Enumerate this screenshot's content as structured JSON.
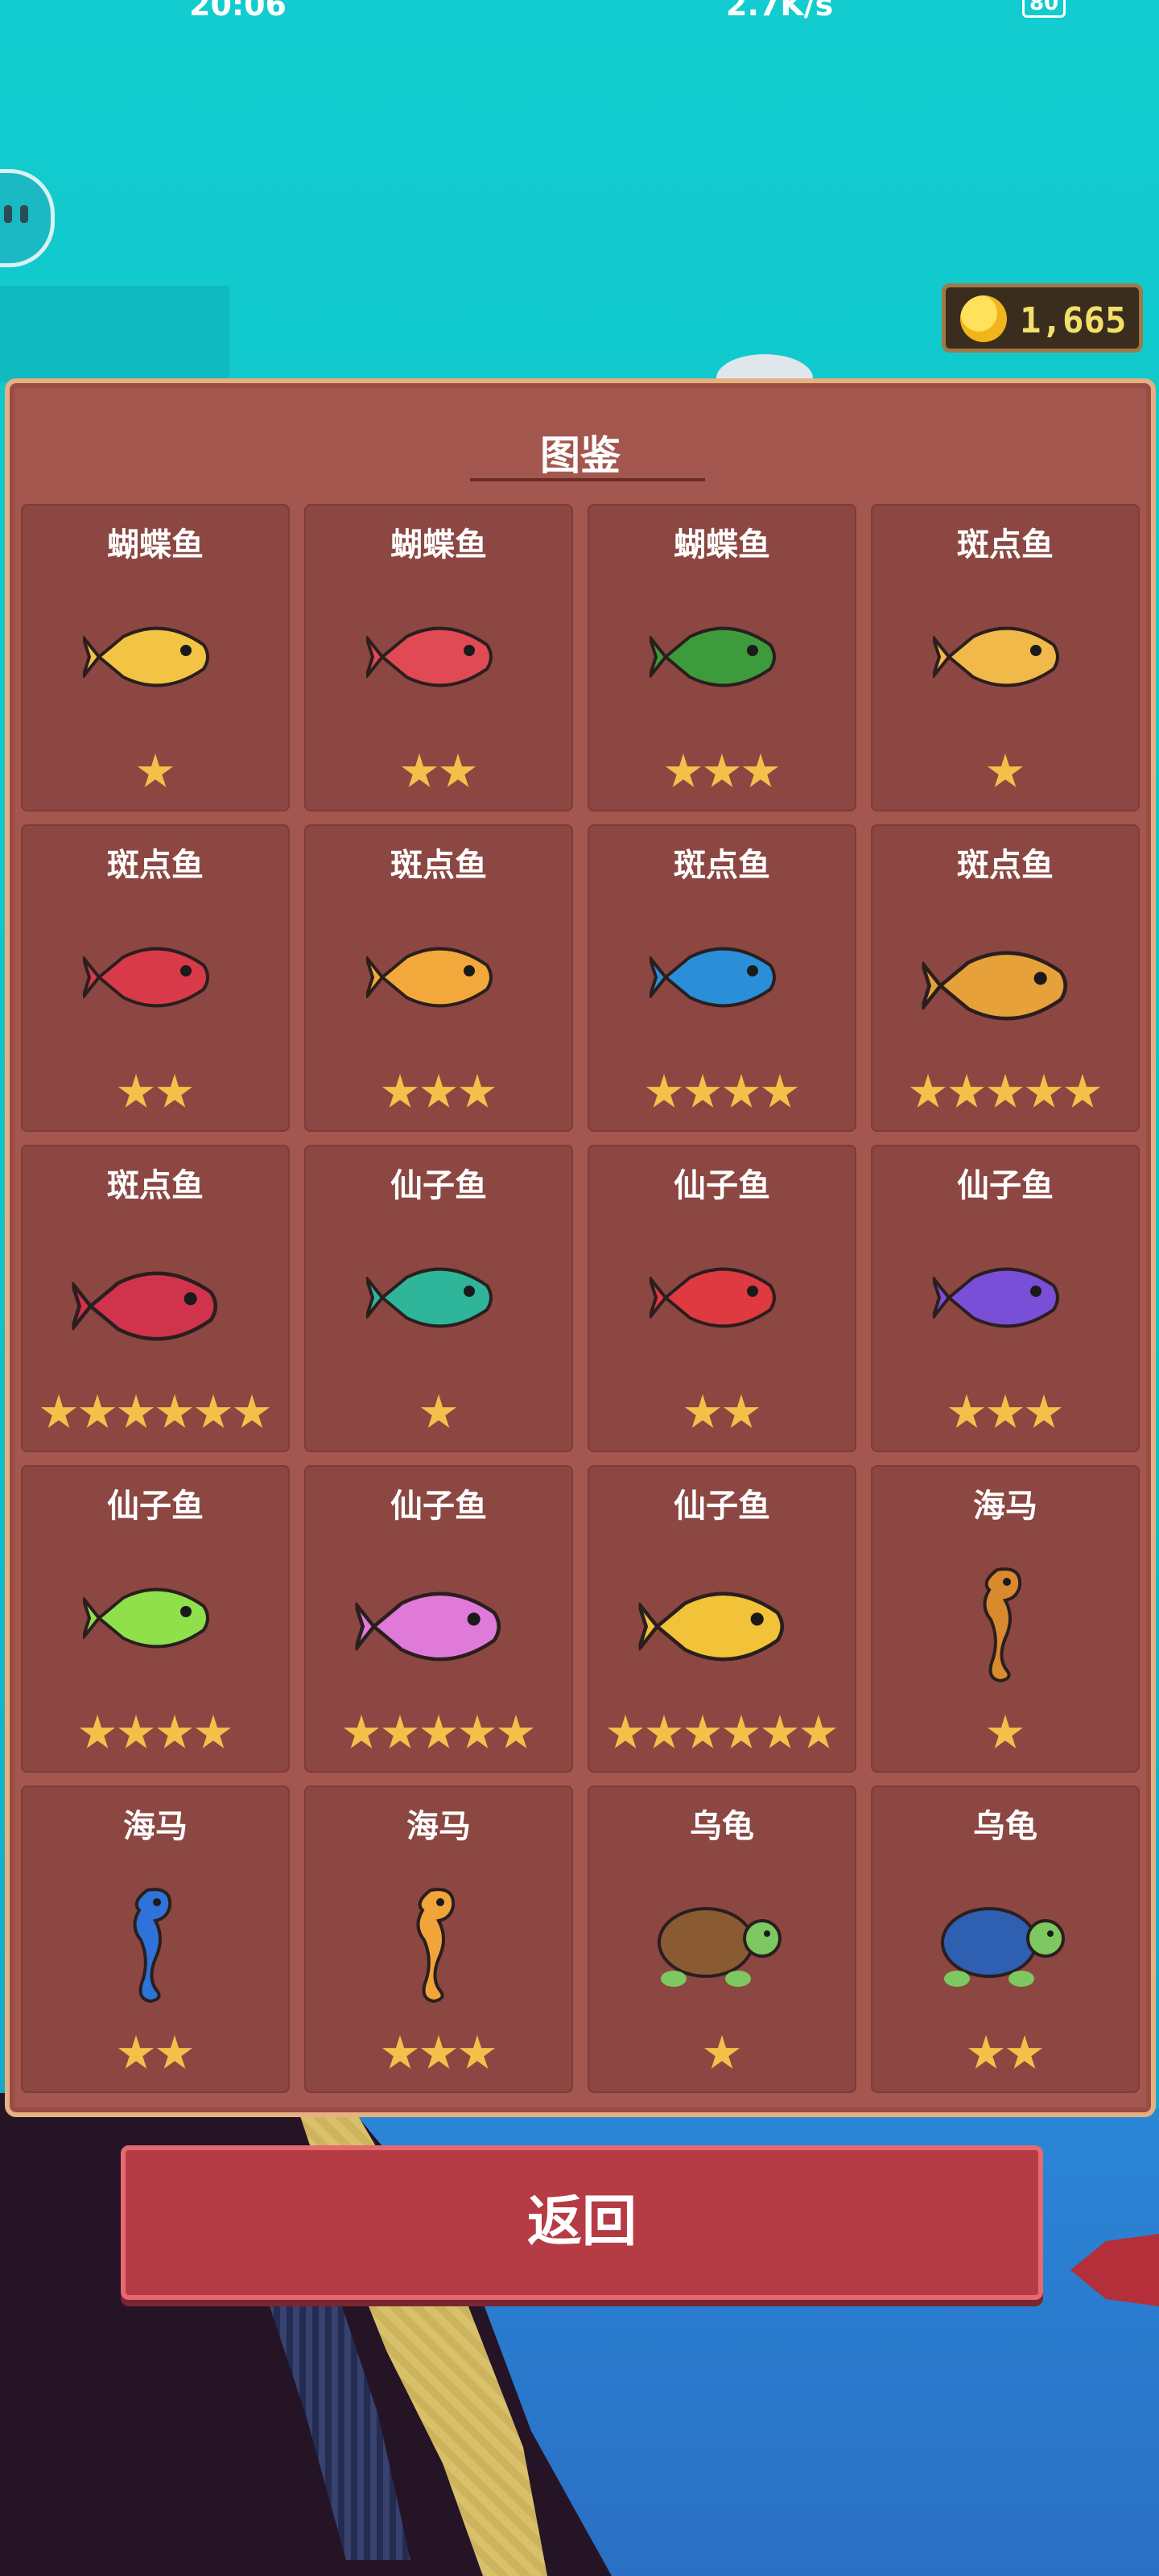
{
  "status_bar": {
    "time": "20:06",
    "net_rate": "2.7K/s",
    "battery": "80"
  },
  "coins": "1,665",
  "colors": {
    "panel": "#a4574f",
    "card": "#8c4742",
    "star": "#f5c04a",
    "button": "#b53c44",
    "coin_text": "#f3e06a"
  },
  "album": {
    "title": "图鉴",
    "items": [
      {
        "name": "蝴蝶鱼",
        "stars": 1,
        "icon": "butterflyfish-yellow",
        "color": "#f3c443"
      },
      {
        "name": "蝴蝶鱼",
        "stars": 2,
        "icon": "butterflyfish-red-green",
        "color": "#e04a55"
      },
      {
        "name": "蝴蝶鱼",
        "stars": 3,
        "icon": "butterflyfish-green-yellow",
        "color": "#3e9b3c"
      },
      {
        "name": "斑点鱼",
        "stars": 1,
        "icon": "spotfish-yellow",
        "color": "#f1b84a"
      },
      {
        "name": "斑点鱼",
        "stars": 2,
        "icon": "spotfish-red",
        "color": "#d83a4a"
      },
      {
        "name": "斑点鱼",
        "stars": 3,
        "icon": "spotfish-orange",
        "color": "#f2a83a"
      },
      {
        "name": "斑点鱼",
        "stars": 4,
        "icon": "spotfish-blue",
        "color": "#2a8fd8"
      },
      {
        "name": "斑点鱼",
        "stars": 5,
        "icon": "spotfish-gold",
        "color": "#e6a13a"
      },
      {
        "name": "斑点鱼",
        "stars": 6,
        "icon": "spotfish-red-cyan",
        "color": "#d0344c"
      },
      {
        "name": "仙子鱼",
        "stars": 1,
        "icon": "fairyfish-teal",
        "color": "#2fb59a"
      },
      {
        "name": "仙子鱼",
        "stars": 2,
        "icon": "fairyfish-red-white",
        "color": "#df3a42"
      },
      {
        "name": "仙子鱼",
        "stars": 3,
        "icon": "fairyfish-purple",
        "color": "#7a4fd8"
      },
      {
        "name": "仙子鱼",
        "stars": 4,
        "icon": "fairyfish-lime",
        "color": "#8fe04b"
      },
      {
        "name": "仙子鱼",
        "stars": 5,
        "icon": "fairyfish-pink",
        "color": "#e07ad8"
      },
      {
        "name": "仙子鱼",
        "stars": 6,
        "icon": "fairyfish-yellow-white",
        "color": "#f2c238"
      },
      {
        "name": "海马",
        "stars": 1,
        "icon": "seahorse-orange",
        "color": "#d98a2e"
      },
      {
        "name": "海马",
        "stars": 2,
        "icon": "seahorse-blue",
        "color": "#2f73d8"
      },
      {
        "name": "海马",
        "stars": 3,
        "icon": "seahorse-gold",
        "color": "#f0a43a"
      },
      {
        "name": "乌龟",
        "stars": 1,
        "icon": "turtle-brown",
        "color": "#8a5a33"
      },
      {
        "name": "乌龟",
        "stars": 2,
        "icon": "turtle-blue",
        "color": "#2f5fb0"
      }
    ]
  },
  "back_button": {
    "label": "返回"
  }
}
